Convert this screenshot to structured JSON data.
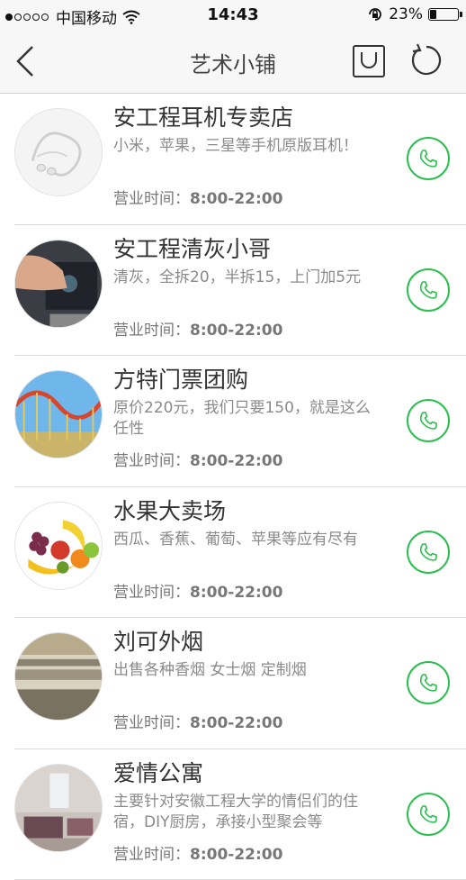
{
  "status_bar": {
    "carrier": "中国移动",
    "time": "14:43",
    "battery_percent": "23%",
    "battery_level": 0.23
  },
  "nav": {
    "title": "艺术小铺",
    "back_icon": "chevron-left-icon",
    "bag_icon": "shopping-bag-icon",
    "refresh_icon": "refresh-icon"
  },
  "colors": {
    "accent_green": "#2bbf4f",
    "nav_bg": "#f7f7f7"
  },
  "hours_label": "营业时间：",
  "shops": [
    {
      "name": "安工程耳机专卖店",
      "desc": "小米，苹果，三星等手机原版耳机！",
      "hours": "8:00-22:00",
      "image": "earphones"
    },
    {
      "name": "安工程清灰小哥",
      "desc": "清灰，全拆20，半拆15，上门加5元",
      "hours": "8:00-22:00",
      "image": "laptop-cleaning"
    },
    {
      "name": "方特门票团购",
      "desc": "原价220元，我们只要150，就是这么任性",
      "hours": "8:00-22:00",
      "image": "roller-coaster"
    },
    {
      "name": "水果大卖场",
      "desc": "西瓜、香蕉、葡萄、苹果等应有尽有",
      "hours": "8:00-22:00",
      "image": "fruit"
    },
    {
      "name": "刘可外烟",
      "desc": "出售各种香烟 女士烟 定制烟",
      "hours": "8:00-22:00",
      "image": "cigarettes"
    },
    {
      "name": "爱情公寓",
      "desc": "主要针对安徽工程大学的情侣们的住宿，DIY厨房，承接小型聚会等",
      "hours": "8:00-22:00",
      "image": "apartment"
    }
  ]
}
